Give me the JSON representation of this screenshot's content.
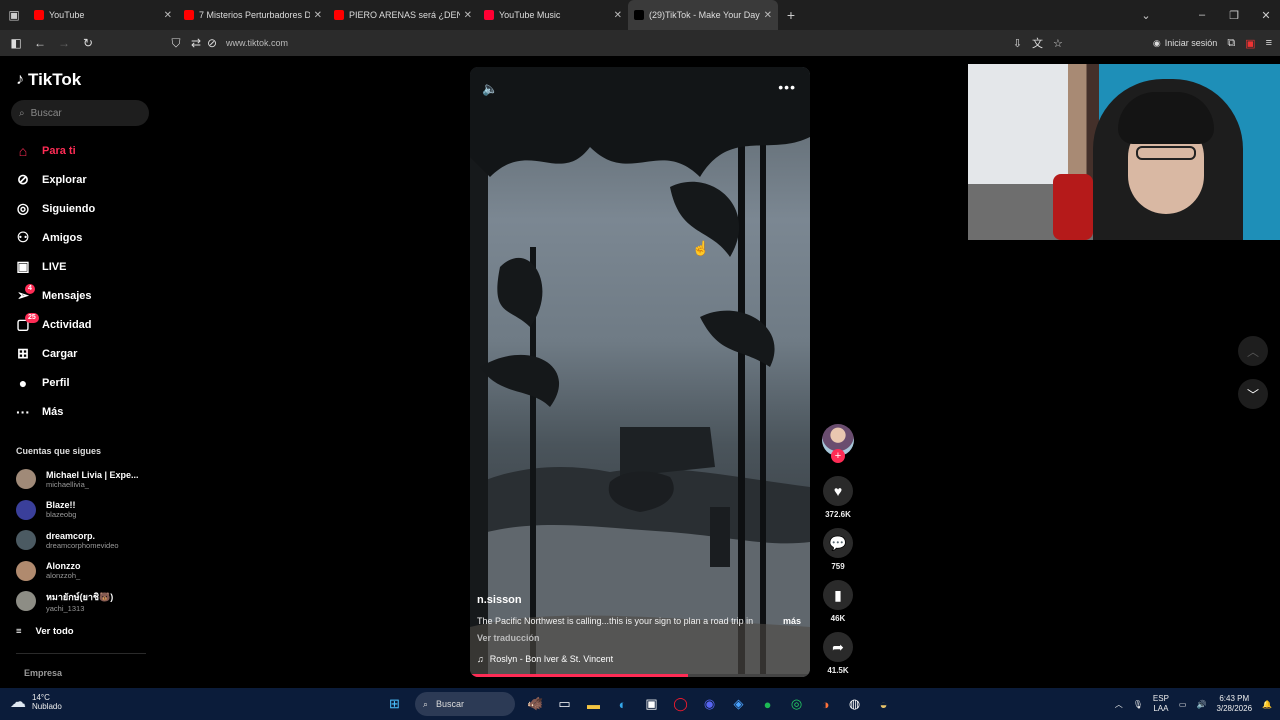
{
  "browser": {
    "tabs": [
      {
        "title": "YouTube",
        "color": "#ff0000",
        "active": false
      },
      {
        "title": "7 Misterios Perturbadores D",
        "color": "#ff0000",
        "active": false
      },
      {
        "title": "PIERO ARENAS será ¿DENUN",
        "color": "#ff0000",
        "active": false
      },
      {
        "title": "YouTube Music",
        "color": "#ff0033",
        "active": false
      },
      {
        "title": "(29)TikTok - Make Your Day",
        "color": "#000000",
        "active": true
      }
    ],
    "url": "www.tiktok.com",
    "login_label": "Iniciar sesión"
  },
  "sidebar": {
    "logo": "TikTok",
    "search_placeholder": "Buscar",
    "nav": [
      {
        "label": "Para ti",
        "icon": "home-icon",
        "active": true,
        "badge": ""
      },
      {
        "label": "Explorar",
        "icon": "compass-icon",
        "active": false,
        "badge": ""
      },
      {
        "label": "Siguiendo",
        "icon": "following-icon",
        "active": false,
        "badge": ""
      },
      {
        "label": "Amigos",
        "icon": "friends-icon",
        "active": false,
        "badge": ""
      },
      {
        "label": "LIVE",
        "icon": "live-icon",
        "active": false,
        "badge": ""
      },
      {
        "label": "Mensajes",
        "icon": "messages-icon",
        "active": false,
        "badge": "4"
      },
      {
        "label": "Actividad",
        "icon": "activity-icon",
        "active": false,
        "badge": "25"
      },
      {
        "label": "Cargar",
        "icon": "upload-icon",
        "active": false,
        "badge": ""
      },
      {
        "label": "Perfil",
        "icon": "profile-avatar",
        "active": false,
        "badge": ""
      },
      {
        "label": "Más",
        "icon": "more-icon",
        "active": false,
        "badge": ""
      }
    ],
    "following_title": "Cuentas que sigues",
    "following": [
      {
        "name": "Michael Livia | Expe...",
        "user": "michaellivia_",
        "color": "#a08a78"
      },
      {
        "name": "Blaze!!",
        "user": "blazeobg",
        "color": "#3a3f9a"
      },
      {
        "name": "dreamcorp.",
        "user": "dreamcorphomevideo",
        "color": "#4b5a62"
      },
      {
        "name": "Alonzzo",
        "user": "alonzzoh_",
        "color": "#b08a6e"
      },
      {
        "name": "หมายักษ์(ยาชิ🐻)",
        "user": "yachi_1313",
        "color": "#8d8d85"
      }
    ],
    "see_all": "Ver todo",
    "company": "Empresa"
  },
  "video": {
    "author": "n.sisson",
    "caption": "The Pacific Northwest is calling...this is your sign to plan a road trip in",
    "more": "más",
    "translate": "Ver traducción",
    "music": "Roslyn - Bon Iver & St. Vincent",
    "progress": 0.64
  },
  "actions": {
    "likes": "372.6K",
    "comments": "759",
    "saves": "46K",
    "shares": "41.5K"
  },
  "taskbar": {
    "temp": "14°C",
    "weather": "Nublado",
    "search": "Buscar",
    "lang1": "ESP",
    "lang2": "LAA",
    "time": "6:43 PM",
    "date": "3/28/2026"
  },
  "colors": {
    "accent": "#fe2c55"
  }
}
